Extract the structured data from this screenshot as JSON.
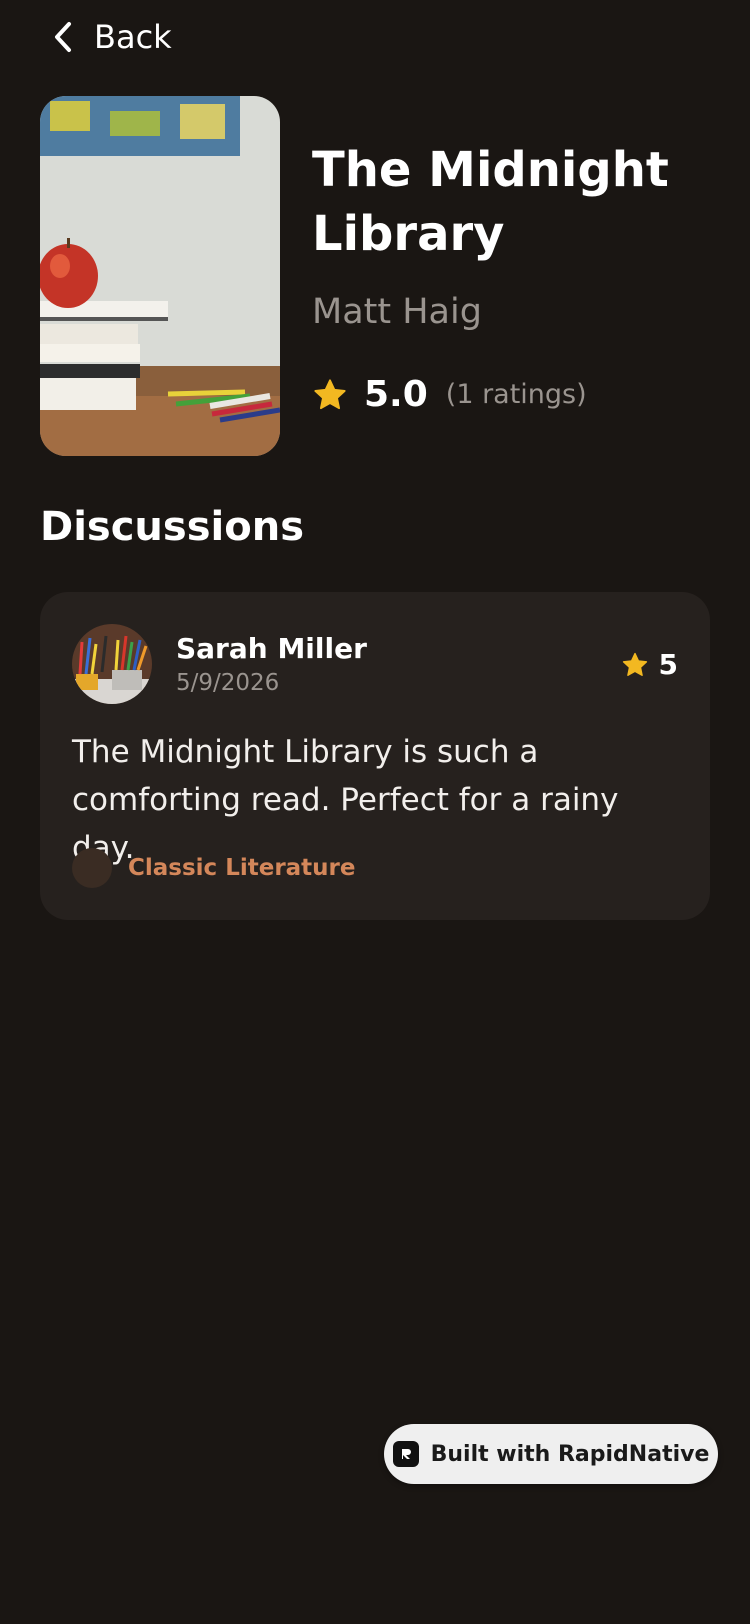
{
  "nav": {
    "back_label": "Back"
  },
  "book": {
    "title": "The Midnight Library",
    "author": "Matt Haig",
    "rating": "5.0",
    "ratings_count": "(1 ratings)"
  },
  "discussions": {
    "heading": "Discussions",
    "posts": [
      {
        "user_name": "Sarah Miller",
        "date": "5/9/2026",
        "rating": "5",
        "body": "The Midnight Library is such a comforting read. Perfect for a rainy day.",
        "tag": "Classic Literature"
      }
    ]
  },
  "badge": {
    "label": "Built with RapidNative"
  },
  "icons": {
    "back": "chevron-left-icon",
    "star": "star-icon",
    "logo": "rapidnative-logo-icon"
  },
  "colors": {
    "background": "#1a1613",
    "card": "#26211e",
    "star": "#f2b821",
    "tag": "#d4875a",
    "muted_text": "#9a948f"
  }
}
